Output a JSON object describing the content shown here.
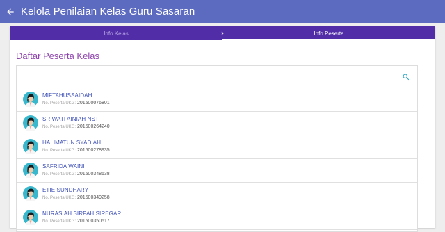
{
  "appbar": {
    "title": "Kelola Penilaian Kelas Guru Sasaran",
    "back_icon": "arrow-left-icon"
  },
  "tabs": [
    {
      "label": "Info Kelas",
      "active": false
    },
    {
      "label": "Info Peserta",
      "active": true
    }
  ],
  "section_title": "Daftar Peserta Kelas",
  "search": {
    "icon": "search-icon"
  },
  "participant_label": "No. Peserta UKG:",
  "participants": [
    {
      "name": "MIFTAHUSSAIDAH",
      "number": "201500076801"
    },
    {
      "name": "SRIWATI AINIAH NST",
      "number": "201500264240"
    },
    {
      "name": "HALIMATUN SYADIAH",
      "number": "201500278935"
    },
    {
      "name": "SAFRIDA WAINI",
      "number": "201500348638"
    },
    {
      "name": "ETIE SUNDHARY",
      "number": "201500349258"
    },
    {
      "name": "NURASIAH SIRPAH SIREGAR",
      "number": "201500350517"
    }
  ],
  "colors": {
    "appbar": "#5c6bc0",
    "tabbar": "#512da8",
    "section_title": "#8e44ad",
    "name": "#3f51b5"
  }
}
